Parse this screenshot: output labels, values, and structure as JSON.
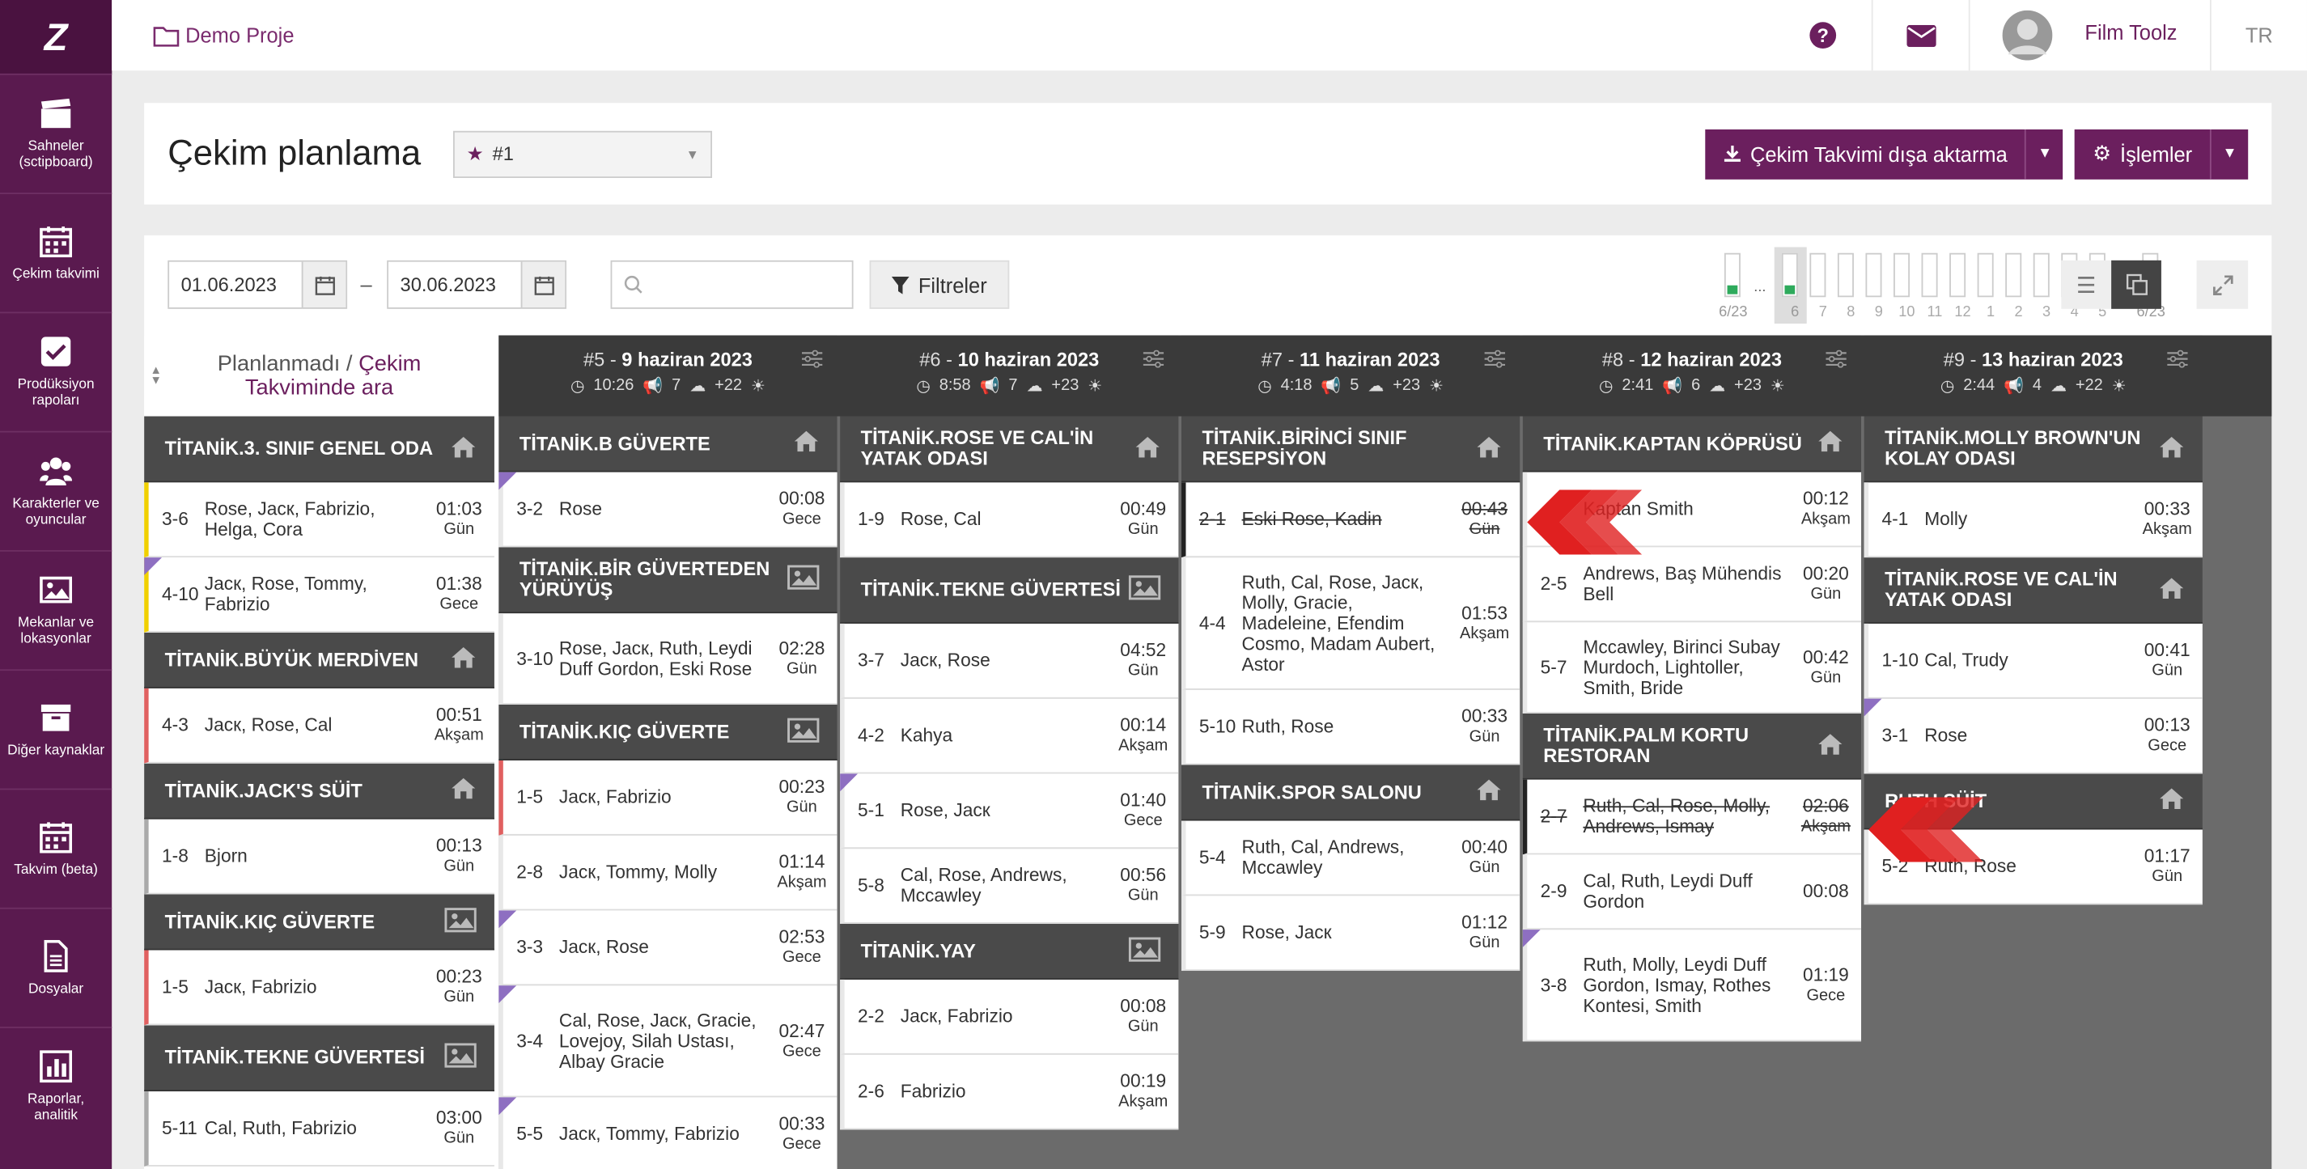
{
  "sidebar": {
    "items": [
      {
        "label": "Sahneler (sctipboard)",
        "icon": "clapperboard-icon"
      },
      {
        "label": "Çekim takvimi",
        "icon": "calendar-icon"
      },
      {
        "label": "Prodüksiyon rapoları",
        "icon": "checkbox-icon"
      },
      {
        "label": "Karakterler ve oyuncular",
        "icon": "users-icon"
      },
      {
        "label": "Mekanlar ve lokasyonlar",
        "icon": "image-icon"
      },
      {
        "label": "Diğer kaynaklar",
        "icon": "archive-icon"
      },
      {
        "label": "Takvim (beta)",
        "icon": "calendar-icon"
      },
      {
        "label": "Dosyalar",
        "icon": "file-icon"
      },
      {
        "label": "Raporlar, analitik",
        "icon": "chart-icon"
      }
    ]
  },
  "topbar": {
    "project": "Demo Proje",
    "user": "Film Toolz",
    "lang": "TR"
  },
  "header": {
    "title": "Çekim planlama",
    "schedule": "#1",
    "export_label": "Çekim Takvimi dışa aktarma",
    "actions_label": "İşlemler"
  },
  "filters": {
    "date_from": "01.06.2023",
    "date_sep": "–",
    "date_to": "30.06.2023",
    "filter_label": "Filtreler"
  },
  "minimap": {
    "first_label": "6/23",
    "last_label": "6/23",
    "ellipsis": "...",
    "days": [
      "6",
      "7",
      "8",
      "9",
      "10",
      "11",
      "12",
      "1",
      "2",
      "3",
      "4",
      "5"
    ]
  },
  "unplanned": {
    "title": "Planlanmadı",
    "sep": "/",
    "link": "Çekim Takviminde ara",
    "groups": [
      {
        "loc": "TİTANİK.3. SINIF GENEL ODA",
        "icon": "home-icon",
        "scenes": [
          {
            "n": "3-6",
            "c": "Rose, Jacк, Fabrizio, Helga, Cora",
            "d": "01:03",
            "p": "Gün"
          },
          {
            "n": "4-10",
            "c": "Jacк, Rose, Tommy, Fabrizio",
            "d": "01:38",
            "p": "Gece"
          }
        ]
      },
      {
        "loc": "TİTANİK.BÜYÜK MERDİVEN",
        "icon": "home-icon",
        "scenes": [
          {
            "n": "4-3",
            "c": "Jacк, Rose, Cal",
            "d": "00:51",
            "p": "Akşam"
          }
        ]
      },
      {
        "loc": "TİTANİK.JACK'S SÜİT",
        "icon": "home-icon",
        "scenes": [
          {
            "n": "1-8",
            "c": "Bjorn",
            "d": "00:13",
            "p": "Gün"
          }
        ]
      },
      {
        "loc": "TİTANİK.KIÇ GÜVERTE",
        "icon": "image-icon",
        "scenes": [
          {
            "n": "1-5",
            "c": "Jacк, Fabrizio",
            "d": "00:23",
            "p": "Gün"
          }
        ]
      },
      {
        "loc": "TİTANİK.TEKNE GÜVERTESİ",
        "icon": "image-icon",
        "scenes": [
          {
            "n": "5-11",
            "c": "Cal, Ruth, Fabrizio",
            "d": "03:00",
            "p": "Gün"
          }
        ]
      }
    ]
  },
  "days": [
    {
      "num": "#5",
      "sep": " - ",
      "date": "9 haziran 2023",
      "time": "10:26",
      "scenes": "7",
      "weather": "+22",
      "groups": [
        {
          "loc": "TİTANİK.B GÜVERTE",
          "icon": "home-icon",
          "scenes": [
            {
              "n": "3-2",
              "c": "Rose",
              "d": "00:08",
              "p": "Gece"
            }
          ]
        },
        {
          "loc": "TİTANİK.BİR GÜVERTEDEN YÜRÜYÜŞ",
          "icon": "image-icon",
          "scenes": [
            {
              "n": "3-10",
              "c": "Rose, Jacк, Ruth, Leydi Duff Gordon, Eski Rose",
              "d": "02:28",
              "p": "Gün"
            }
          ]
        },
        {
          "loc": "TİTANİK.KIÇ GÜVERTE",
          "icon": "image-icon",
          "scenes": [
            {
              "n": "1-5",
              "c": "Jacк, Fabrizio",
              "d": "00:23",
              "p": "Gün"
            },
            {
              "n": "2-8",
              "c": "Jacк, Tommy, Molly",
              "d": "01:14",
              "p": "Akşam"
            },
            {
              "n": "3-3",
              "c": "Jacк, Rose",
              "d": "02:53",
              "p": "Gece"
            },
            {
              "n": "3-4",
              "c": "Cal, Rose, Jacк, Gracie, Lovejoy, Silah Ustası, Albay Gracie",
              "d": "02:47",
              "p": "Gece"
            },
            {
              "n": "5-5",
              "c": "Jacк, Tommy, Fabrizio",
              "d": "00:33",
              "p": "Gece"
            }
          ]
        }
      ]
    },
    {
      "num": "#6",
      "sep": " - ",
      "date": "10 haziran 2023",
      "time": "8:58",
      "scenes": "7",
      "weather": "+23",
      "groups": [
        {
          "loc": "TİTANİK.ROSE VE CAL'İN YATAK ODASI",
          "icon": "home-icon",
          "scenes": [
            {
              "n": "1-9",
              "c": "Rose, Cal",
              "d": "00:49",
              "p": "Gün"
            }
          ]
        },
        {
          "loc": "TİTANİK.TEKNE GÜVERTESİ",
          "icon": "image-icon",
          "scenes": [
            {
              "n": "3-7",
              "c": "Jacк, Rose",
              "d": "04:52",
              "p": "Gün"
            },
            {
              "n": "4-2",
              "c": "Kahya",
              "d": "00:14",
              "p": "Akşam"
            },
            {
              "n": "5-1",
              "c": "Rose, Jacк",
              "d": "01:40",
              "p": "Gece"
            },
            {
              "n": "5-8",
              "c": "Cal, Rose, Andrews, Mccawley",
              "d": "00:56",
              "p": "Gün"
            }
          ]
        },
        {
          "loc": "TİTANİK.YAY",
          "icon": "image-icon",
          "scenes": [
            {
              "n": "2-2",
              "c": "Jacк, Fabrizio",
              "d": "00:08",
              "p": "Gün"
            },
            {
              "n": "2-6",
              "c": "Fabrizio",
              "d": "00:19",
              "p": "Akşam"
            }
          ]
        }
      ]
    },
    {
      "num": "#7",
      "sep": " - ",
      "date": "11 haziran 2023",
      "time": "4:18",
      "scenes": "5",
      "weather": "+23",
      "groups": [
        {
          "loc": "TİTANİK.BİRİNCİ SINIF RESEPSİYON",
          "icon": "home-icon",
          "scenes": [
            {
              "n": "2-1",
              "c": "Eski Rose, Kadin",
              "d": "00:43",
              "p": "Gün",
              "strike": true
            },
            {
              "n": "4-4",
              "c": "Ruth, Cal, Rose, Jacк, Molly, Gracie, Madeleine, Efendim Cosmo, Madam Aubert, Astor",
              "d": "01:53",
              "p": "Akşam"
            },
            {
              "n": "5-10",
              "c": "Ruth, Rose",
              "d": "00:33",
              "p": "Gün"
            }
          ]
        },
        {
          "loc": "TİTANİK.SPOR SALONU",
          "icon": "home-icon",
          "scenes": [
            {
              "n": "5-4",
              "c": "Ruth, Cal, Andrews, Mccawley",
              "d": "00:40",
              "p": "Gün"
            },
            {
              "n": "5-9",
              "c": "Rose, Jacк",
              "d": "01:12",
              "p": "Gün"
            }
          ]
        }
      ]
    },
    {
      "num": "#8",
      "sep": " - ",
      "date": "12 haziran 2023",
      "time": "2:41",
      "scenes": "6",
      "weather": "+23",
      "groups": [
        {
          "loc": "TİTANİK.KAPTAN KÖPRÜSÜ",
          "icon": "home-icon",
          "scenes": [
            {
              "n": "",
              "c": "Kaptan Smith",
              "d": "00:12",
              "p": "Akşam"
            },
            {
              "n": "2-5",
              "c": "Andrews, Baş Mühendis Bell",
              "d": "00:20",
              "p": "Gün"
            },
            {
              "n": "5-7",
              "c": "Mccawley, Birinci Subay Murdoch, Lightoller, Smith, Bride",
              "d": "00:42",
              "p": "Gün"
            }
          ]
        },
        {
          "loc": "TİTANİK.PALM KORTU RESTORAN",
          "icon": "home-icon",
          "scenes": [
            {
              "n": "2-7",
              "c": "Ruth, Cal, Rose, Molly, Andrews, Ismay",
              "d": "02:06",
              "p": "Akşam",
              "strike": true
            },
            {
              "n": "2-9",
              "c": "Cal, Ruth, Leydi Duff Gordon",
              "d": "00:08",
              "p": ""
            },
            {
              "n": "3-8",
              "c": "Ruth, Molly, Leydi Duff Gordon, Ismay, Rothes Kontesi, Smith",
              "d": "01:19",
              "p": "Gece"
            }
          ]
        }
      ]
    },
    {
      "num": "#9",
      "sep": " - ",
      "date": "13 haziran 2023",
      "time": "2:44",
      "scenes": "4",
      "weather": "+22",
      "groups": [
        {
          "loc": "TİTANİK.MOLLY BROWN'UN KOLAY ODASI",
          "icon": "home-icon",
          "scenes": [
            {
              "n": "4-1",
              "c": "Molly",
              "d": "00:33",
              "p": "Akşam"
            }
          ]
        },
        {
          "loc": "TİTANİK.ROSE VE CAL'İN YATAK ODASI",
          "icon": "home-icon",
          "scenes": [
            {
              "n": "1-10",
              "c": "Cal, Trudy",
              "d": "00:41",
              "p": "Gün"
            },
            {
              "n": "3-1",
              "c": "Rose",
              "d": "00:13",
              "p": "Gece"
            }
          ]
        },
        {
          "loc": "RUTH SÜİT",
          "icon": "home-icon",
          "scenes": [
            {
              "n": "5-2",
              "c": "Ruth, Rose",
              "d": "01:17",
              "p": "Gün"
            }
          ]
        }
      ]
    }
  ],
  "colors": {
    "accent": "#6b1f5e",
    "sidebar": "#5a1a4f",
    "dark": "#3a3a3a",
    "loc": "#4a4a4a",
    "arrow": "#e02020"
  }
}
